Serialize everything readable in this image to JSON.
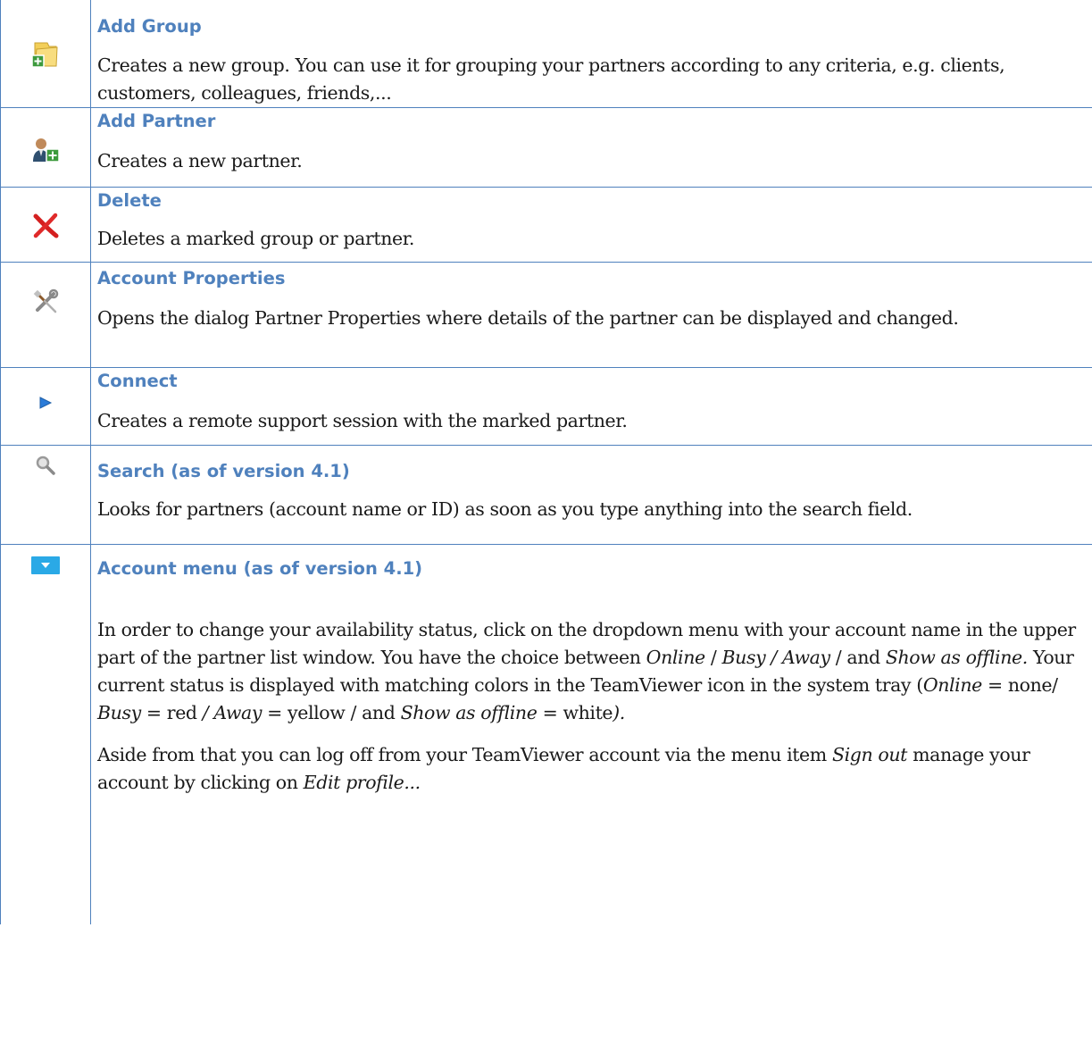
{
  "rows": [
    {
      "icon": "folder-add-icon",
      "title": "Add Group",
      "text": "Creates a new group. You can use it for grouping your partners according to any criteria, e.g. clients, customers, colleagues, friends,..."
    },
    {
      "icon": "user-add-icon",
      "title": "Add Partner",
      "text": "Creates a new partner."
    },
    {
      "icon": "delete-x-icon",
      "title": "Delete",
      "text": "Deletes a marked group or partner."
    },
    {
      "icon": "tools-icon",
      "title": "Account Properties",
      "text": "Opens the dialog Partner Properties where details of the partner can be displayed and changed."
    },
    {
      "icon": "play-arrow-icon",
      "title": "Connect",
      "text": "Creates a remote support session with the marked partner."
    },
    {
      "icon": "magnifier-icon",
      "title": "Search (as of version 4.1)",
      "text": "Looks for partners (account name or ID) as soon as you type anything into the search field."
    },
    {
      "icon": "dropdown-arrow-icon",
      "title": "Account menu (as of version 4.1)",
      "p1_a": "In order to change your availability status, click on the dropdown menu with your account name in the upper part of the partner list window. You have the choice between ",
      "p1_online": "Online",
      "p1_b": " / ",
      "p1_busy_away": "Busy / Away",
      "p1_c": " / and ",
      "p1_offline": "Show as offline.",
      "p1_d": " Your current status is displayed with matching colors in the TeamViewer icon in the system tray (",
      "p1_online2": "Online",
      "p1_e": " = none/ ",
      "p1_busy2": "Busy",
      "p1_f": " = red ",
      "p1_away2": "/ Away",
      "p1_g": " = yellow / and ",
      "p1_offline2": "Show as offline",
      "p1_h": " = white",
      "p1_end": ").",
      "p2_a": "Aside from that you can log off from your TeamViewer account via the menu item ",
      "p2_signout": "Sign out",
      "p2_b": " manage your account by clicking on ",
      "p2_edit": "Edit profile..."
    }
  ],
  "colors": {
    "border": "#4f81bd",
    "title": "#4f81bd"
  }
}
